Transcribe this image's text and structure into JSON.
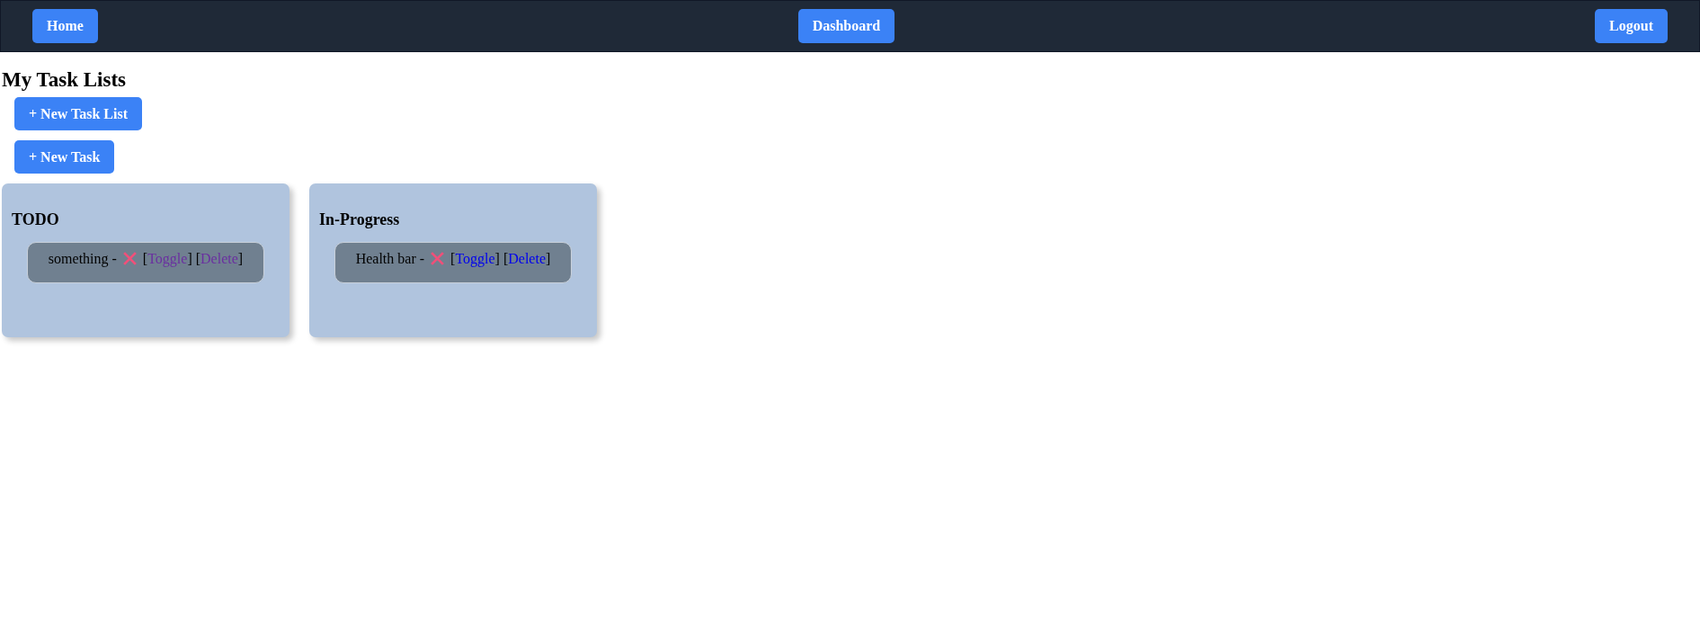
{
  "nav": {
    "left": "Home",
    "center": "Dashboard",
    "right": "Logout"
  },
  "heading": "My Task Lists",
  "actions": [
    "+ New Task List",
    "+ New Task"
  ],
  "brackets": {
    "open": "[",
    "close": "]"
  },
  "lists": [
    {
      "title": "TODO",
      "tasks": [
        {
          "text": "something -",
          "done": false,
          "links": [
            {
              "label": "Toggle",
              "visited": true
            },
            {
              "label": "Delete",
              "visited": true
            }
          ]
        }
      ]
    },
    {
      "title": "In-Progress",
      "tasks": [
        {
          "text": "Health bar -",
          "done": false,
          "links": [
            {
              "label": "Toggle",
              "visited": false
            },
            {
              "label": "Delete",
              "visited": false
            }
          ]
        }
      ]
    }
  ]
}
